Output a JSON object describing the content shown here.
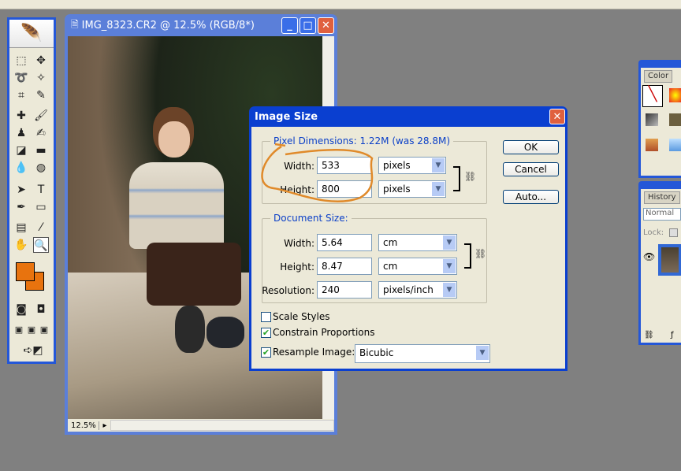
{
  "document": {
    "title": "IMG_8323.CR2 @ 12.5% (RGB/8*)",
    "zoom": "12.5%"
  },
  "toolbox": {
    "foreground_color": "#e8730e",
    "background_color": "#e8730e"
  },
  "dialog": {
    "title": "Image Size",
    "pixel_dimensions": {
      "legend": "Pixel Dimensions:  1.22M (was 28.8M)",
      "width_label": "Width:",
      "width": "533",
      "width_unit": "pixels",
      "height_label": "Height:",
      "height": "800",
      "height_unit": "pixels"
    },
    "document_size": {
      "legend": "Document Size:",
      "width_label": "Width:",
      "width": "5.64",
      "width_unit": "cm",
      "height_label": "Height:",
      "height": "8.47",
      "height_unit": "cm",
      "resolution_label": "Resolution:",
      "resolution": "240",
      "resolution_unit": "pixels/inch"
    },
    "scale_styles": {
      "label": "Scale Styles",
      "checked": false
    },
    "constrain": {
      "label": "Constrain Proportions",
      "checked": true
    },
    "resample": {
      "label": "Resample Image:",
      "checked": true,
      "method": "Bicubic"
    },
    "buttons": {
      "ok": "OK",
      "cancel": "Cancel",
      "auto": "Auto..."
    },
    "annotation_color": "#e08a2a"
  },
  "color_panel": {
    "tab": "Color"
  },
  "layers_panel": {
    "tab": "History",
    "blend_mode": "Normal",
    "lock_label": "Lock:"
  }
}
